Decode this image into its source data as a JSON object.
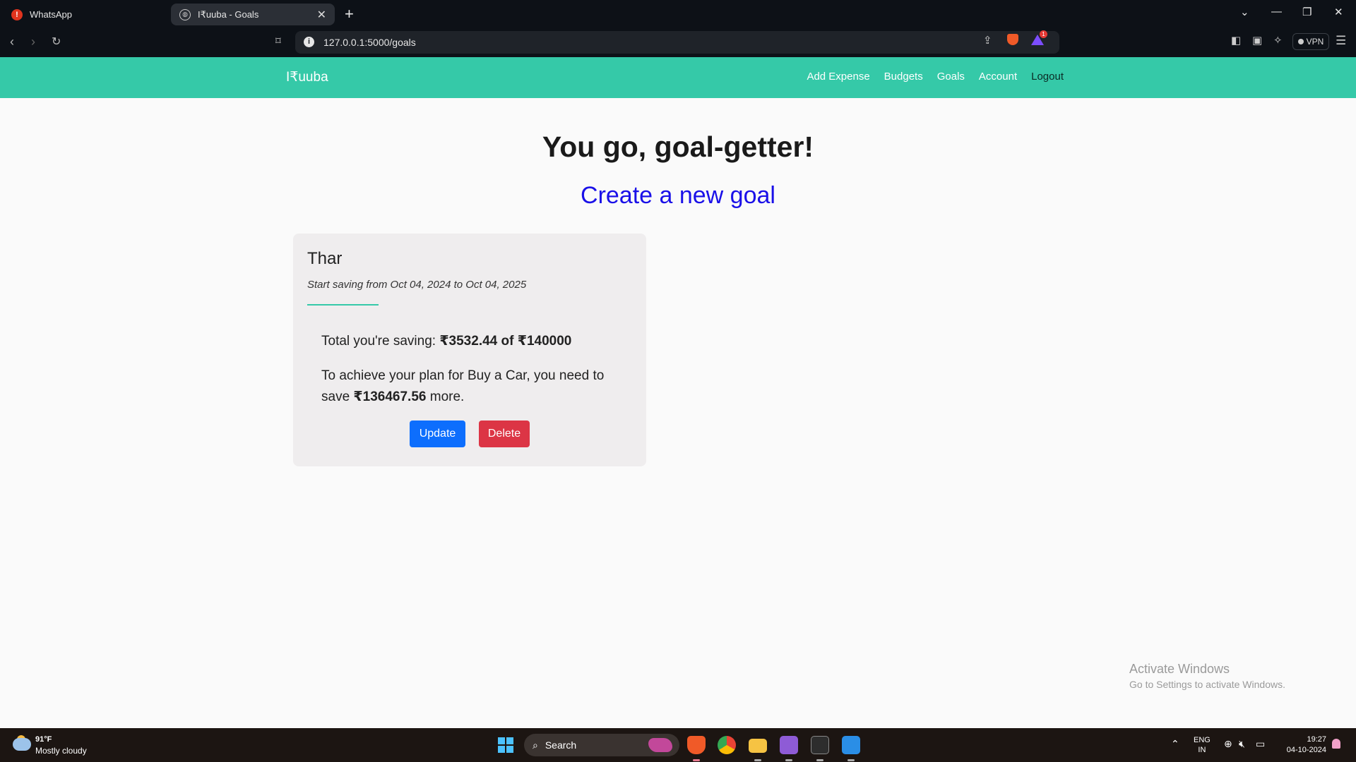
{
  "browser": {
    "tabs": [
      {
        "title": "WhatsApp",
        "active": false
      },
      {
        "title": "I₹uuba - Goals",
        "active": true
      }
    ],
    "url": "127.0.0.1:5000/goals",
    "vpn_label": "VPN",
    "rewards_count": "1"
  },
  "navbar": {
    "brand": "I₹uuba",
    "links": [
      "Add Expense",
      "Budgets",
      "Goals",
      "Account",
      "Logout"
    ]
  },
  "main": {
    "heading": "You go, goal-getter!",
    "create_link": "Create a new goal"
  },
  "goal": {
    "name": "Thar",
    "dates": "Start saving from Oct 04, 2024 to Oct 04, 2025",
    "saving_prefix": "Total you're saving: ",
    "saving_value": "₹3532.44 of ₹140000",
    "need_prefix": "To achieve your plan for Buy a Car, you need to save ",
    "need_value": "₹136467.56",
    "need_suffix": " more.",
    "update_label": "Update",
    "delete_label": "Delete"
  },
  "watermark": {
    "title": "Activate Windows",
    "subtitle": "Go to Settings to activate Windows."
  },
  "taskbar": {
    "weather_temp": "91°F",
    "weather_desc": "Mostly cloudy",
    "search_label": "Search",
    "lang_line1": "ENG",
    "lang_line2": "IN",
    "time": "19:27",
    "date": "04-10-2024"
  },
  "colors": {
    "navbar": "#35c9a8",
    "update_button": "#0d6efd",
    "delete_button": "#dc3545",
    "link": "#1a10e8"
  }
}
